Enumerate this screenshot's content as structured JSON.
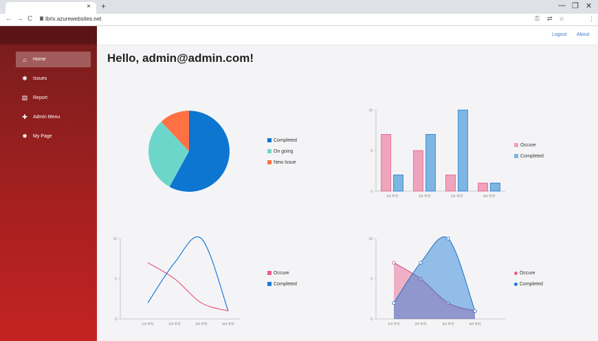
{
  "browser": {
    "tab_close": "×",
    "new_tab": "+",
    "url": "ibrix.azurewebsites.net",
    "win_min": "—",
    "win_restore": "❐",
    "win_close": "✕",
    "nav_back": "←",
    "nav_fwd": "→",
    "nav_reload": "C",
    "menu": "⋮"
  },
  "sidebar": {
    "items": [
      {
        "label": "Home",
        "icon": "home-icon",
        "glyph": "⌂",
        "active": true
      },
      {
        "label": "Issues",
        "icon": "bug-icon",
        "glyph": "✱",
        "active": false
      },
      {
        "label": "Report",
        "icon": "document-icon",
        "glyph": "▤",
        "active": false
      },
      {
        "label": "Admin Menu",
        "icon": "plus-icon",
        "glyph": "✚",
        "active": false
      },
      {
        "label": "My Page",
        "icon": "gear-icon",
        "glyph": "✹",
        "active": false
      }
    ]
  },
  "topbar": {
    "logout": "Logout",
    "about": "About"
  },
  "main": {
    "greeting": "Hello, admin@admin.com!"
  },
  "colors": {
    "pink": "#e85d89",
    "blue": "#1a7ad8",
    "teal": "#6dd6ca",
    "orange": "#ff7043",
    "completed": "#0d76d0"
  },
  "chart_data": [
    {
      "type": "pie",
      "categories": [
        "Completed",
        "On going",
        "New Issue"
      ],
      "values": [
        58,
        30,
        12
      ],
      "colors": [
        "#0d76d0",
        "#6dd6ca",
        "#ff7043"
      ]
    },
    {
      "type": "bar",
      "categories": [
        "1/4 주차",
        "2/4 주차",
        "3/4 주차",
        "4/4 주차"
      ],
      "series": [
        {
          "name": "Occure",
          "values": [
            7,
            5,
            2,
            1
          ]
        },
        {
          "name": "Completed",
          "values": [
            2,
            7,
            10,
            1
          ]
        }
      ],
      "ylim": [
        0,
        10
      ],
      "yticks": [
        "0",
        "5",
        "10"
      ]
    },
    {
      "type": "line",
      "categories": [
        "1/4 주차",
        "2/4 주차",
        "3/4 주차",
        "4/4 주차"
      ],
      "series": [
        {
          "name": "Occure",
          "values": [
            7,
            5,
            2,
            1
          ]
        },
        {
          "name": "Completed",
          "values": [
            2,
            7,
            10,
            1
          ]
        }
      ],
      "ylim": [
        0,
        10
      ],
      "yticks": [
        "0",
        "5",
        "10"
      ]
    },
    {
      "type": "area",
      "categories": [
        "1/4 주차",
        "2/4 주차",
        "3/4 주차",
        "4/4 주차"
      ],
      "series": [
        {
          "name": "Occure",
          "values": [
            7,
            5,
            2,
            1
          ]
        },
        {
          "name": "Completed",
          "values": [
            2,
            7,
            10,
            1
          ]
        }
      ],
      "ylim": [
        0,
        10
      ],
      "yticks": [
        "0",
        "5",
        "10"
      ]
    }
  ]
}
